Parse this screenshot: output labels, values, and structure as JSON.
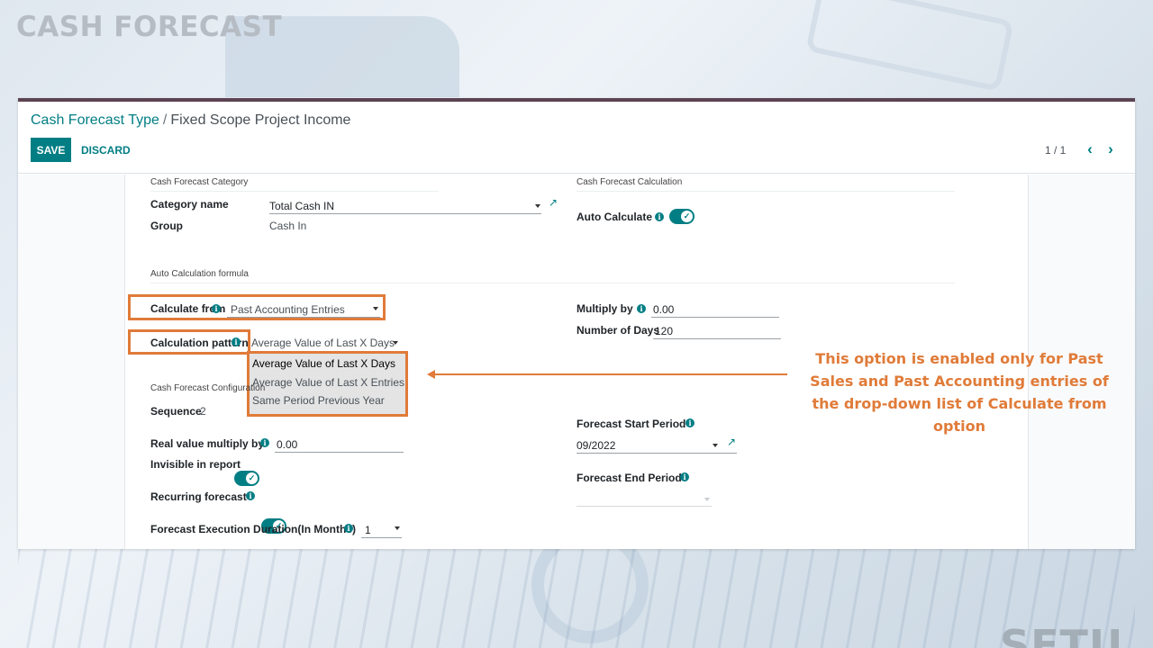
{
  "slide": {
    "title": "CASH FORECAST",
    "watermark": "SETU"
  },
  "breadcrumb": {
    "parent": "Cash Forecast Type",
    "separator": "/",
    "current": "Fixed Scope Project Income"
  },
  "toolbar": {
    "save_label": "SAVE",
    "discard_label": "DISCARD",
    "pager": "1 / 1",
    "prev_icon": "chevron-left-icon",
    "next_icon": "chevron-right-icon"
  },
  "sections": {
    "category": "Cash Forecast Category",
    "calculation": "Cash Forecast Calculation",
    "formula": "Auto Calculation formula",
    "configuration": "Cash Forecast Configuration"
  },
  "fields": {
    "category_name": {
      "label": "Category name",
      "value": "Total Cash IN"
    },
    "group": {
      "label": "Group",
      "value": "Cash In"
    },
    "auto_calculate": {
      "label": "Auto Calculate",
      "enabled": true
    },
    "calculate_from": {
      "label": "Calculate from",
      "value": "Past Accounting Entries"
    },
    "calculation_pattern": {
      "label": "Calculation pattern",
      "value": "Average Value of Last X Days"
    },
    "multiply_by": {
      "label": "Multiply by",
      "value": "0.00"
    },
    "number_of_days": {
      "label": "Number of Days",
      "value": "120"
    },
    "sequence": {
      "label": "Sequence",
      "value": "2"
    },
    "real_value_multiply_by": {
      "label": "Real value multiply by",
      "value": "0.00"
    },
    "invisible_in_report": {
      "label": "Invisible in report",
      "enabled": true
    },
    "recurring_forecast": {
      "label": "Recurring forecast",
      "enabled": true
    },
    "forecast_execution_duration": {
      "label": "Forecast Execution Duration(In Months)",
      "value": "1"
    },
    "forecast_start_period": {
      "label": "Forecast Start Period",
      "value": "09/2022"
    },
    "forecast_end_period": {
      "label": "Forecast End Period",
      "value": ""
    }
  },
  "calculation_pattern_options": [
    "Average Value of Last X Days",
    "Average Value of Last X Entries",
    "Same Period Previous Year"
  ],
  "callout": {
    "text": "This option is enabled only for Past Sales and Past Accounting entries of the drop-down list of Calculate from option"
  },
  "colors": {
    "accent": "#017e84",
    "highlight": "#e07b39",
    "header_border": "#5c4352"
  }
}
